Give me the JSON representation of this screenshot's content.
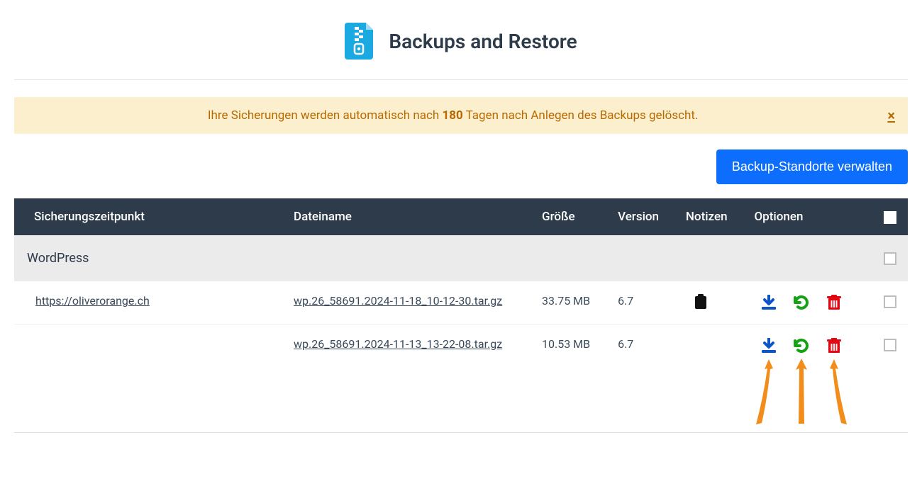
{
  "header": {
    "title": "Backups and Restore"
  },
  "alert": {
    "pre": "Ihre Sicherungen werden automatisch nach ",
    "days": "180",
    "post": " Tagen nach Anlegen des Backups gelöscht.",
    "close": "×"
  },
  "toolbar": {
    "manage_locations": "Backup-Standorte verwalten"
  },
  "columns": {
    "time": "Sicherungszeitpunkt",
    "filename": "Dateiname",
    "size": "Größe",
    "version": "Version",
    "notes": "Notizen",
    "options": "Optionen"
  },
  "group": {
    "label": "WordPress"
  },
  "rows": [
    {
      "site": "https://oliverorange.ch",
      "filename": "wp.26_58691.2024-11-18_10-12-30.tar.gz",
      "size": "33.75 MB",
      "version": "6.7",
      "has_note": true
    },
    {
      "site": "",
      "filename": "wp.26_58691.2024-11-13_13-22-08.tar.gz",
      "size": "10.53 MB",
      "version": "6.7",
      "has_note": false
    }
  ]
}
